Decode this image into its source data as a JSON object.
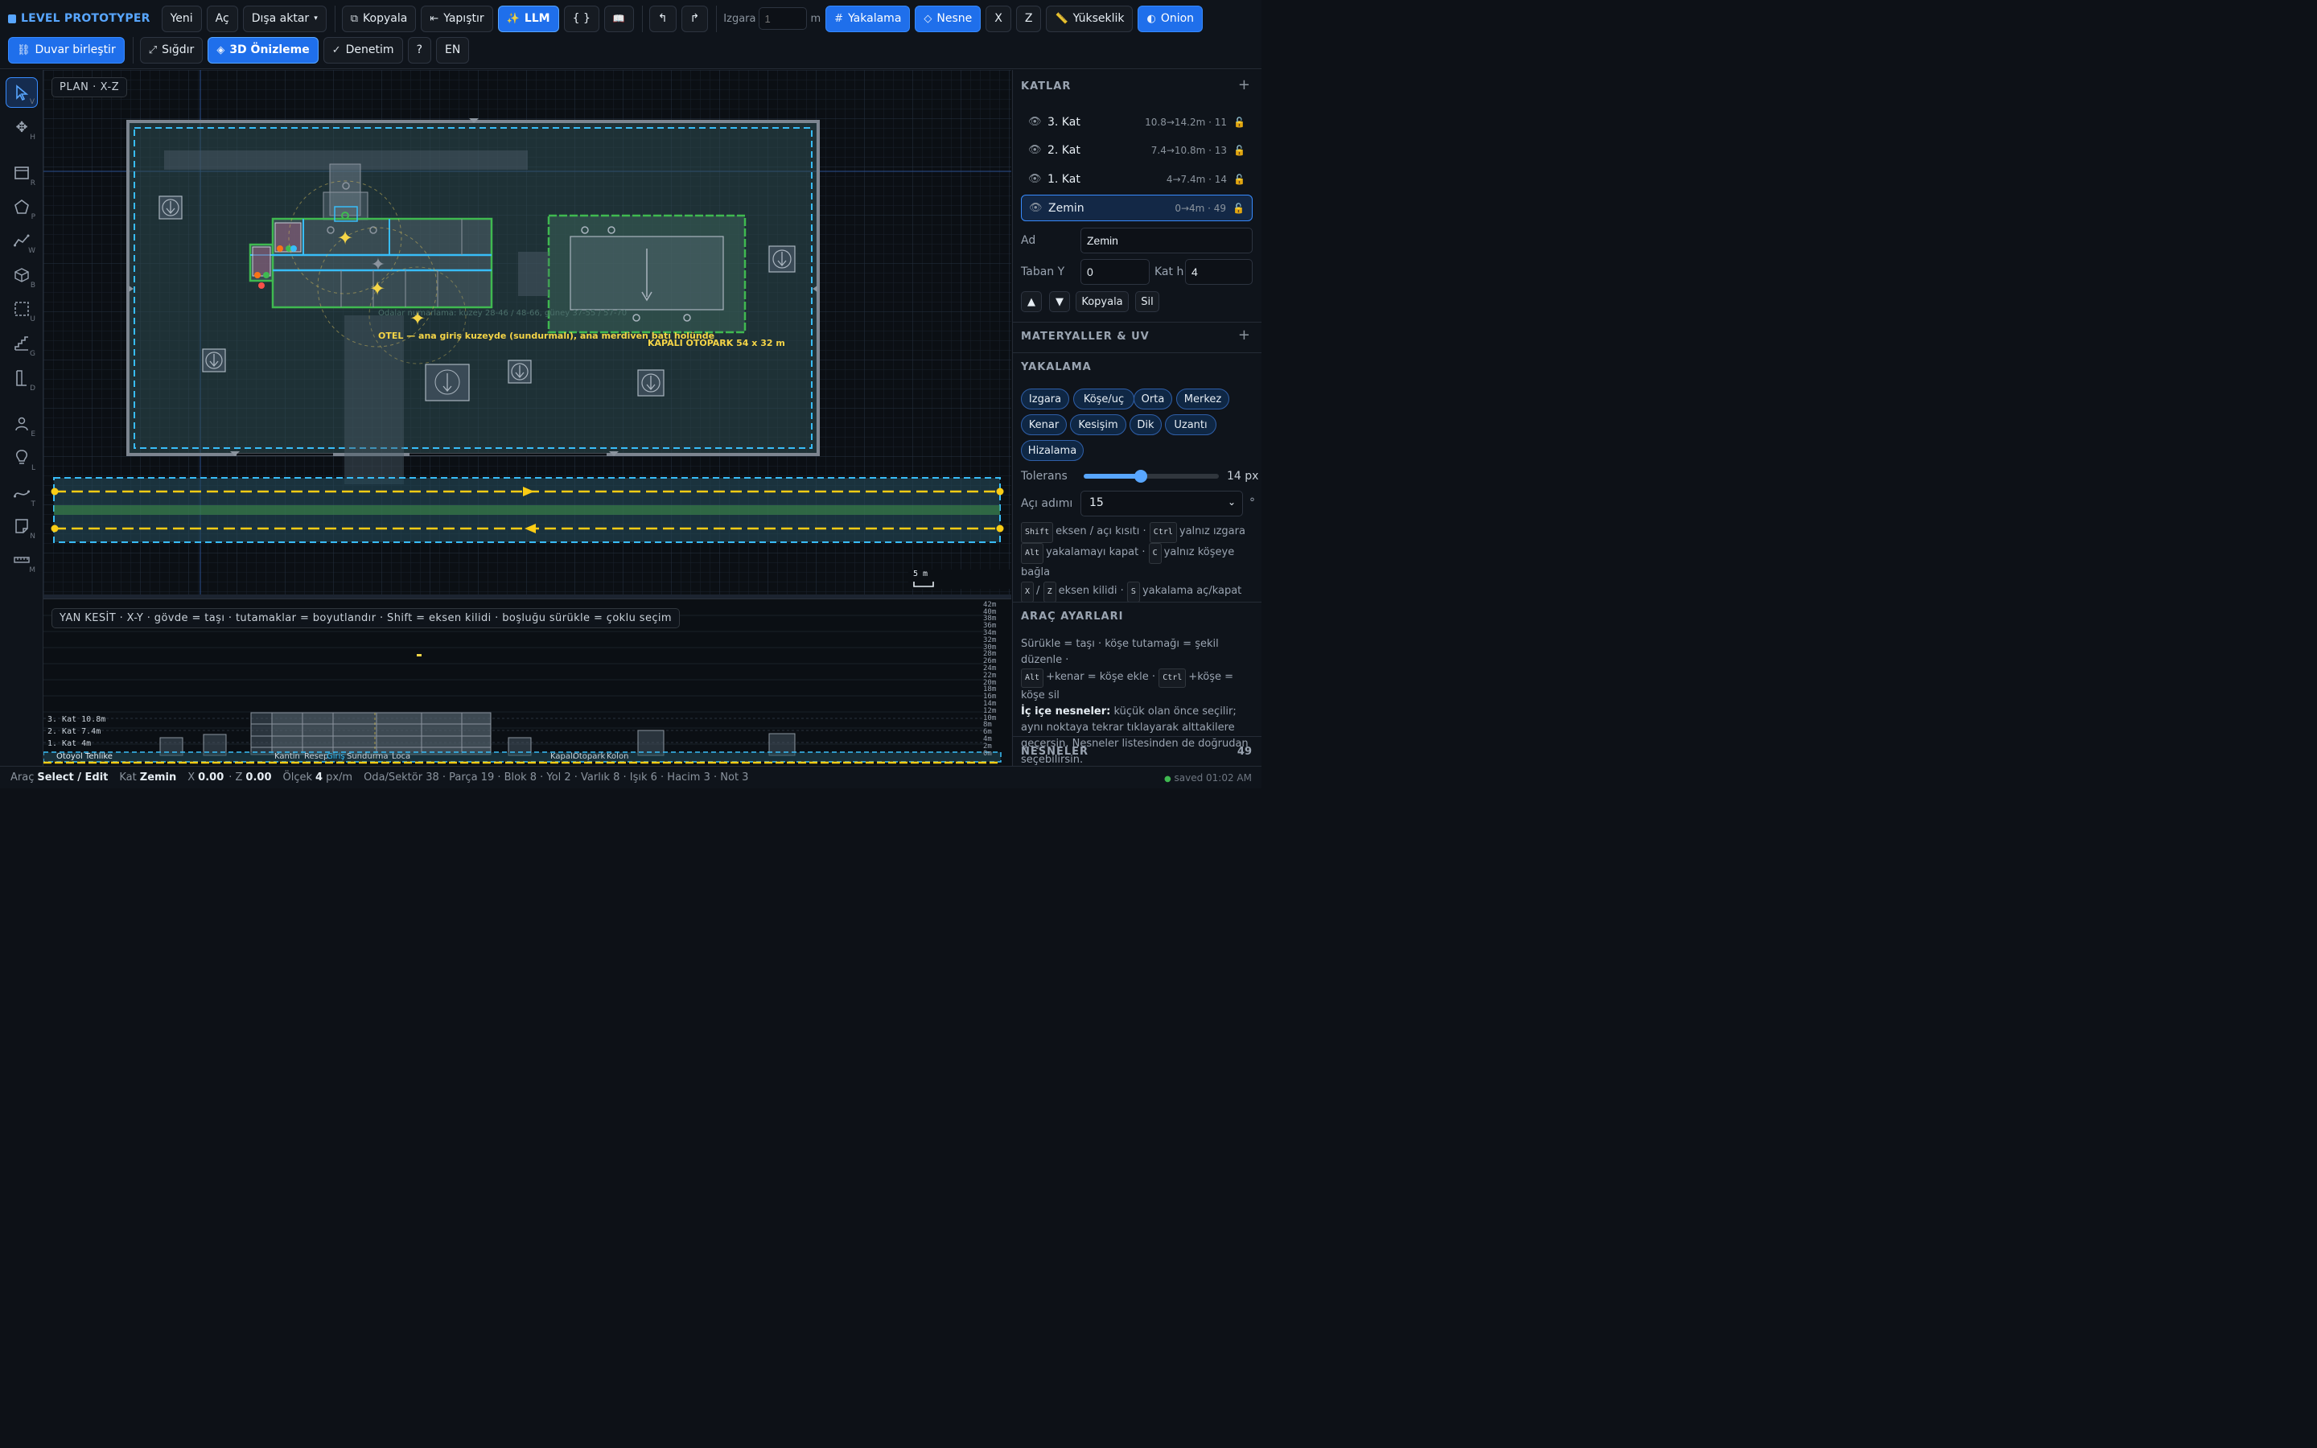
{
  "app": {
    "title": "LEVEL PROTOTYPER"
  },
  "toolbar": {
    "new": "Yeni",
    "open": "Aç",
    "export": "Dışa aktar",
    "copy": "Kopyala",
    "paste": "Yapıştır",
    "llm": "LLM",
    "json": "{ }",
    "docs": "📖",
    "undo": "↰",
    "redo": "↱",
    "grid_label": "Izgara",
    "grid_placeholder": "1",
    "grid_unit": "m",
    "snap": "Yakalama",
    "object": "Nesne",
    "axis_x": "X",
    "axis_z": "Z",
    "height": "Yükseklik",
    "onion": "Onion",
    "merge_walls": "Duvar birleştir",
    "fit": "Sığdır",
    "preview3d": "3D Önizleme",
    "audit": "Denetim",
    "help": "?",
    "lang": "EN"
  },
  "tools": [
    {
      "name": "select",
      "key": "V"
    },
    {
      "name": "move",
      "key": "H"
    },
    {
      "name": "room",
      "key": "R"
    },
    {
      "name": "polygon",
      "key": "P"
    },
    {
      "name": "wall",
      "key": "W"
    },
    {
      "name": "block",
      "key": "B"
    },
    {
      "name": "volume",
      "key": "U"
    },
    {
      "name": "stairs",
      "key": "G"
    },
    {
      "name": "door",
      "key": "D"
    },
    {
      "name": "entity",
      "key": "E"
    },
    {
      "name": "light",
      "key": "L"
    },
    {
      "name": "path",
      "key": "T"
    },
    {
      "name": "note",
      "key": "N"
    },
    {
      "name": "measure",
      "key": "M"
    }
  ],
  "plan": {
    "view_label": "PLAN · X-Z",
    "hotel_label": "OTEL — ana giriş kuzeyde (sundurmalı), ana merdiven batı holünde",
    "rooms_note": "Odalar numarlama: kuzey 28-46 / 48-66, güney 37-55 / 57-70",
    "parking_label": "KAPALI OTOPARK 54 x 32 m",
    "scale_label": "5 m"
  },
  "side": {
    "view_label": "YAN KESİT · X-Y · gövde = taşı · tutamaklar = boyutlandır · Shift = eksen kilidi · boşluğu sürükle = çoklu seçim",
    "ruler": [
      "44m",
      "42m",
      "40m",
      "38m",
      "36m",
      "34m",
      "32m",
      "30m",
      "28m",
      "26m",
      "24m",
      "22m",
      "20m",
      "18m",
      "16m",
      "14m",
      "12m",
      "10m",
      "8m",
      "6m",
      "4m",
      "2m",
      "0m"
    ],
    "floors": [
      {
        "label": "3. Kat",
        "val": "10.8m"
      },
      {
        "label": "2. Kat",
        "val": "7.4m"
      },
      {
        "label": "1. Kat",
        "val": "4m"
      }
    ],
    "bottom_labels": [
      "Otoyol Tehlike",
      "Kantin",
      "Resep",
      "Giriş",
      "Sundurma",
      "Loca",
      "Kapalı",
      "Otopark",
      "Kolon"
    ]
  },
  "panel": {
    "layers_title": "KATLAR",
    "layers": [
      {
        "name": "3. Kat",
        "range": "10.8→14.2m · 11",
        "selected": false
      },
      {
        "name": "2. Kat",
        "range": "7.4→10.8m · 13",
        "selected": false
      },
      {
        "name": "1. Kat",
        "range": "4→7.4m · 14",
        "selected": false
      },
      {
        "name": "Zemin",
        "range": "0→4m · 49",
        "selected": true
      }
    ],
    "name_label": "Ad",
    "name_value": "Zemin",
    "base_label": "Taban Y",
    "base_value": "0",
    "floorh_label": "Kat h",
    "floorh_value": "4",
    "up": "▲",
    "down": "▼",
    "copy": "Kopyala",
    "delete": "Sil",
    "materials_title": "MATERYALLER & UV",
    "snap_title": "YAKALAMA",
    "chips": [
      "Izgara",
      "Köşe/uç",
      "Orta",
      "Merkez",
      "Kenar",
      "Kesişim",
      "Dik",
      "Uzantı",
      "Hizalama"
    ],
    "tolerance_label": "Tolerans",
    "tolerance_value": "14 px",
    "tolerance_level": 0.42,
    "angle_label": "Açı adımı",
    "angle_value": "15",
    "angle_unit": "°",
    "hint1_a": "eksen / açı kısıtı ·",
    "hint1_b": "yalnız ızgara",
    "hint2_a": "yakalamayı kapat ·",
    "hint2_b": "yalnız köşeye bağla",
    "hint3_a": "/",
    "hint3_b": "eksen kilidi ·",
    "hint3_c": "yakalama aç/kapat",
    "keys": {
      "shift": "Shift",
      "ctrl": "Ctrl",
      "alt": "Alt",
      "c": "C",
      "x": "X",
      "z": "Z",
      "s": "S"
    },
    "tool_settings_title": "ARAÇ AYARLARI",
    "tool_hint_1": "Sürükle = taşı · köşe tutamağı = şekil düzenle ·",
    "tool_hint_2a": "+kenar = köşe ekle ·",
    "tool_hint_2b": "+köşe =",
    "tool_hint_3": "köşe sil",
    "nested_title": "İç içe nesneler:",
    "nested_text": "küçük olan önce seçilir; aynı noktaya tekrar tıklayarak alttakilere geçersin. Nesneler listesinden de doğrudan seçebilirsin.",
    "objects_title": "NESNELER",
    "objects_count": "49"
  },
  "status": {
    "tool_label": "Araç",
    "tool_value": "Select / Edit",
    "floor_label": "Kat",
    "floor_value": "Zemin",
    "x_label": "X",
    "x_value": "0.00",
    "z_label": "· Z",
    "z_value": "0.00",
    "scale_label": "Ölçek",
    "scale_value": "4",
    "scale_unit": "px/m",
    "counts": "Oda/Sektör 38 · Parça 19 · Blok 8 · Yol 2 · Varlık 8 · Işık 6 · Hacim 3 · Not 3",
    "saved": "saved 01:02 AM"
  },
  "colors": {
    "accent": "#1f6feb",
    "room": "#3fb950",
    "selection": "#38bdf8",
    "road": "#facc15"
  }
}
